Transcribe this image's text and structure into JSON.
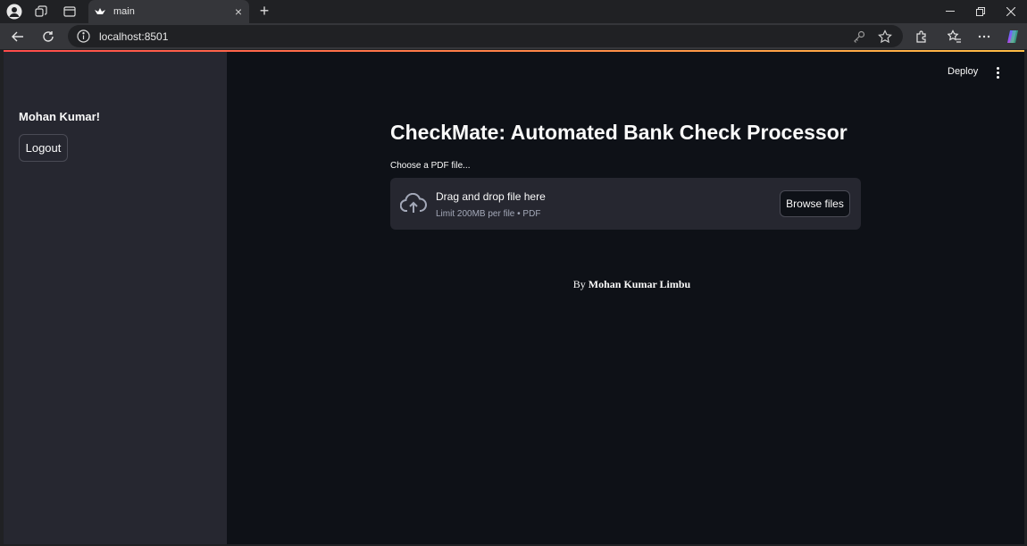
{
  "browser": {
    "tab_title": "main",
    "url": "localhost:8501"
  },
  "app": {
    "sidebar": {
      "user_greeting": "Mohan Kumar!",
      "logout_label": "Logout"
    },
    "header": {
      "deploy_label": "Deploy"
    },
    "title": "CheckMate: Automated Bank Check Processor",
    "uploader": {
      "label": "Choose a PDF file...",
      "drop_text": "Drag and drop file here",
      "limit_text": "Limit 200MB per file • PDF",
      "browse_label": "Browse files"
    },
    "byline": {
      "prefix": "By",
      "author": "Mohan Kumar Limbu"
    }
  },
  "colors": {
    "background": "#0e1117",
    "sidebar": "#262730",
    "text": "#fafafa",
    "accent_start": "#ff4b4b",
    "accent_end": "#ffbd45"
  }
}
